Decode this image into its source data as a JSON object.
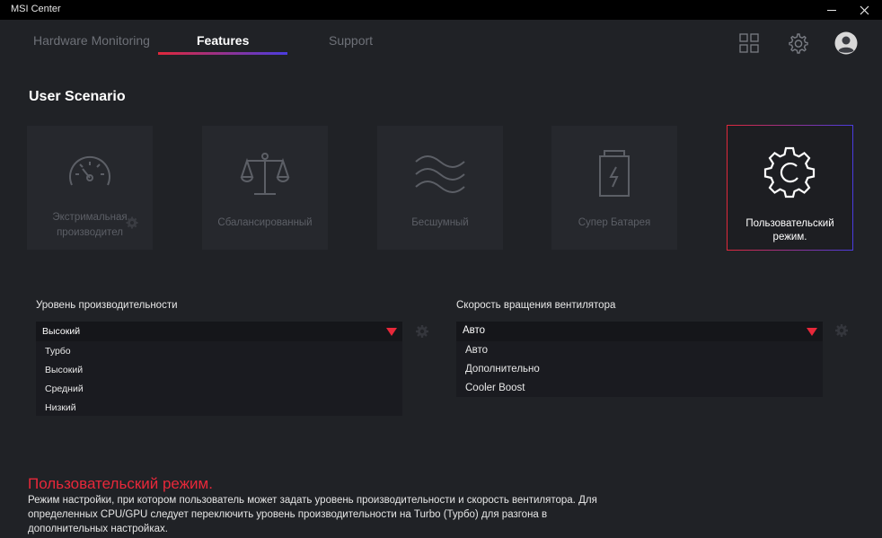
{
  "window": {
    "title": "MSI Center"
  },
  "nav": {
    "tabs": [
      {
        "label": "Hardware Monitoring",
        "active": false
      },
      {
        "label": "Features",
        "active": true
      },
      {
        "label": "Support",
        "active": false
      }
    ],
    "icons": [
      "apps-grid-icon",
      "settings-gear-icon",
      "user-avatar-icon"
    ]
  },
  "section": {
    "title": "User Scenario"
  },
  "scenarios": [
    {
      "label": "Экстримальная производител",
      "icon": "speedometer-icon",
      "selected": false
    },
    {
      "label": "Сбалансированный",
      "icon": "balance-scale-icon",
      "selected": false
    },
    {
      "label": "Бесшумный",
      "icon": "waves-icon",
      "selected": false
    },
    {
      "label": "Супер Батарея",
      "icon": "battery-bolt-icon",
      "selected": false
    },
    {
      "label": "Пользовательский режим.",
      "icon": "gear-icon",
      "selected": true
    }
  ],
  "performance": {
    "label": "Уровень производительности",
    "selected": "Высокий",
    "options": [
      "Турбо",
      "Высокий",
      "Средний",
      "Низкий"
    ]
  },
  "fan": {
    "label": "Скорость вращения вентилятора",
    "selected": "Авто",
    "options": [
      "Авто",
      "Дополнительно",
      "Cooler Boost"
    ]
  },
  "description": {
    "title": "Пользовательский режим.",
    "text": "Режим настройки, при котором пользователь может задать уровень производительности и скорость вентилятора. Для определенных CPU/GPU следует переключить уровень производительности на Turbo (Турбо) для разгона в дополнительных настройках."
  },
  "colors": {
    "accent_red": "#e8283a",
    "accent_blue": "#4a3ce0",
    "background": "#202226"
  }
}
